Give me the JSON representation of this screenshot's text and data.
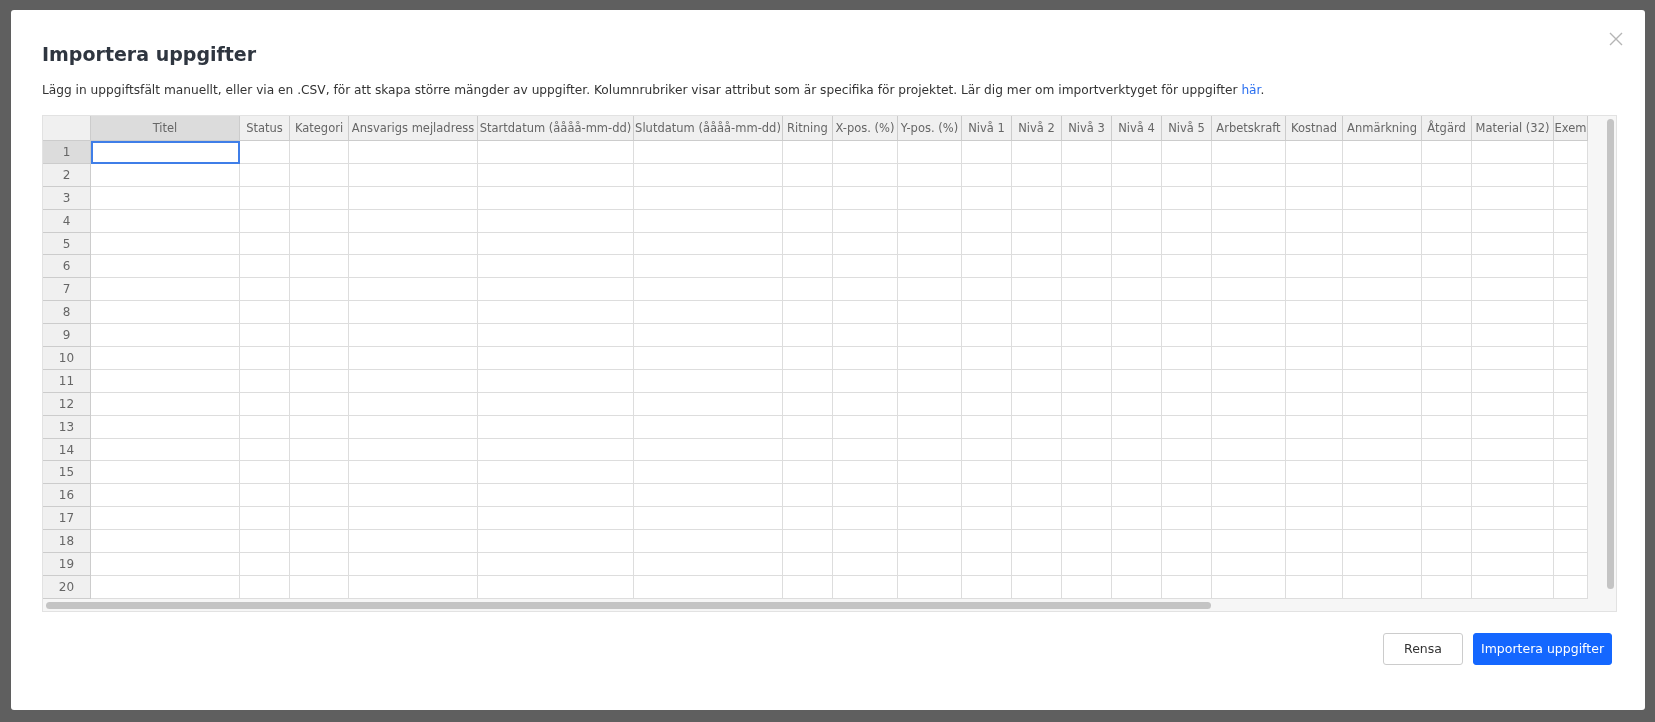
{
  "dialog": {
    "title": "Importera uppgifter",
    "description": "Lägg in uppgiftsfält manuellt, eller via en .CSV, för att skapa större mängder av uppgifter. Kolumnrubriker visar attribut som är specifika för projektet. Lär dig mer om importverktyget för uppgifter ",
    "link": "här",
    "description_end": "."
  },
  "table": {
    "columns": [
      {
        "label": "Titel",
        "selected": true
      },
      {
        "label": "Status",
        "selected": false
      },
      {
        "label": "Kategori",
        "selected": false
      },
      {
        "label": "Ansvarigs mejladress",
        "selected": false
      },
      {
        "label": "Startdatum (åååå-mm-dd)",
        "selected": false
      },
      {
        "label": "Slutdatum (åååå-mm-dd)",
        "selected": false
      },
      {
        "label": "Ritning",
        "selected": false
      },
      {
        "label": "X-pos. (%)",
        "selected": false
      },
      {
        "label": "Y-pos. (%)",
        "selected": false
      },
      {
        "label": "Nivå 1",
        "selected": false
      },
      {
        "label": "Nivå 2",
        "selected": false
      },
      {
        "label": "Nivå 3",
        "selected": false
      },
      {
        "label": "Nivå 4",
        "selected": false
      },
      {
        "label": "Nivå 5",
        "selected": false
      },
      {
        "label": "Arbetskraft",
        "selected": false
      },
      {
        "label": "Kostnad",
        "selected": false
      },
      {
        "label": "Anmärkning",
        "selected": false
      },
      {
        "label": "Åtgärd",
        "selected": false
      },
      {
        "label": "Material (32)",
        "selected": false
      },
      {
        "label": "Exem",
        "selected": false
      }
    ],
    "rows": [
      {
        "number": "1",
        "selected": true
      },
      {
        "number": "2",
        "selected": false
      },
      {
        "number": "3",
        "selected": false
      },
      {
        "number": "4",
        "selected": false
      },
      {
        "number": "5",
        "selected": false
      },
      {
        "number": "6",
        "selected": false
      },
      {
        "number": "7",
        "selected": false
      },
      {
        "number": "8",
        "selected": false
      },
      {
        "number": "9",
        "selected": false
      },
      {
        "number": "10",
        "selected": false
      },
      {
        "number": "11",
        "selected": false
      },
      {
        "number": "12",
        "selected": false
      },
      {
        "number": "13",
        "selected": false
      },
      {
        "number": "14",
        "selected": false
      },
      {
        "number": "15",
        "selected": false
      },
      {
        "number": "16",
        "selected": false
      },
      {
        "number": "17",
        "selected": false
      },
      {
        "number": "18",
        "selected": false
      },
      {
        "number": "19",
        "selected": false
      },
      {
        "number": "20",
        "selected": false
      }
    ]
  },
  "buttons": [
    {
      "label": "Rensa",
      "kind": "secondary"
    },
    {
      "label": "Importera uppgifter",
      "kind": "primary"
    }
  ]
}
